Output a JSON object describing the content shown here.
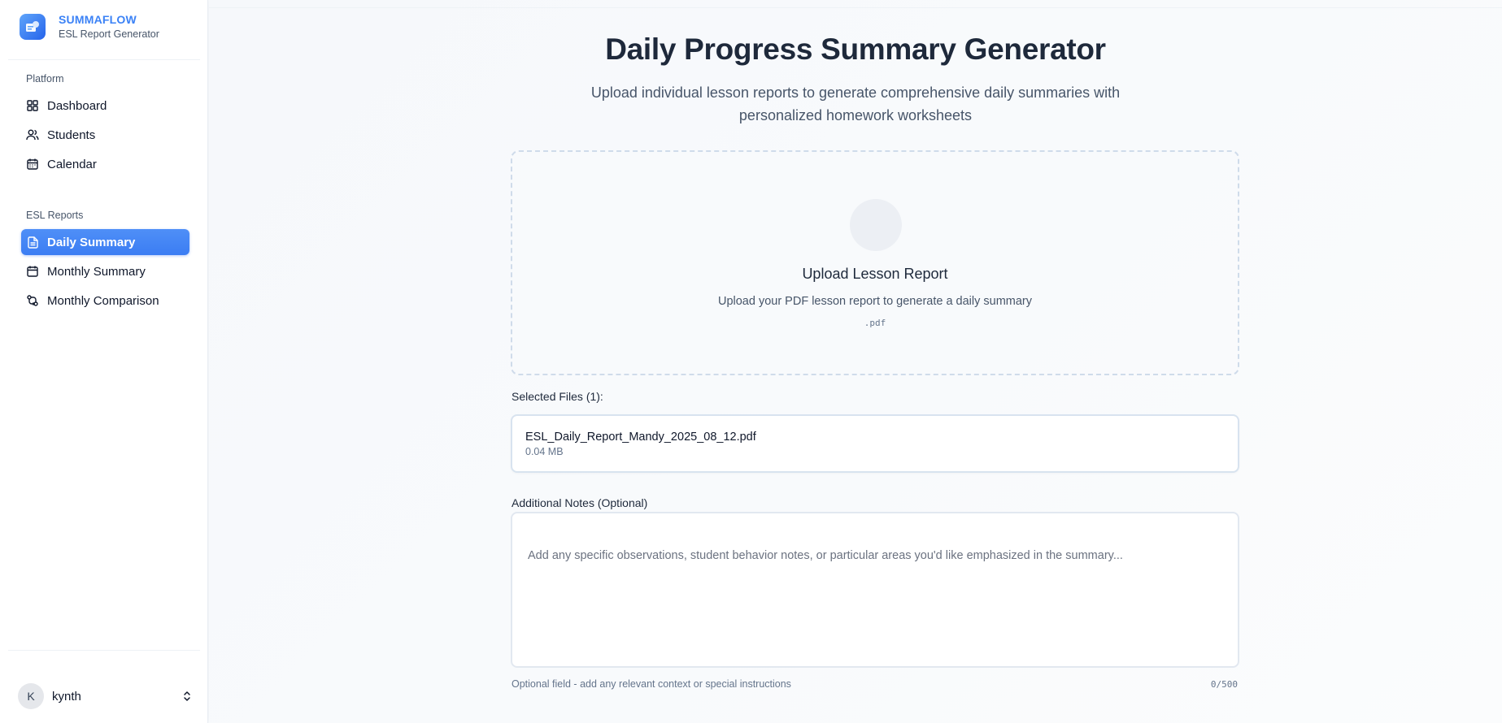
{
  "brand": {
    "name": "SUMMAFLOW",
    "subtitle": "ESL Report Generator",
    "logo_icon": "report-logo-icon"
  },
  "sidebar": {
    "sections": [
      {
        "label": "Platform",
        "items": [
          {
            "label": "Dashboard",
            "icon": "grid-icon"
          },
          {
            "label": "Students",
            "icon": "users-icon"
          },
          {
            "label": "Calendar",
            "icon": "calendar-icon"
          }
        ]
      },
      {
        "label": "ESL Reports",
        "items": [
          {
            "label": "Daily Summary",
            "icon": "file-text-icon",
            "active": true
          },
          {
            "label": "Monthly Summary",
            "icon": "calendar-icon"
          },
          {
            "label": "Monthly Comparison",
            "icon": "git-compare-icon"
          }
        ]
      }
    ],
    "user": {
      "initial": "K",
      "name": "kynth",
      "menu_icon": "chevrons-up-down-icon"
    }
  },
  "main": {
    "title": "Daily Progress Summary Generator",
    "subtitle": "Upload individual lesson reports to generate comprehensive daily summaries with personalized homework worksheets",
    "upload": {
      "title": "Upload Lesson Report",
      "description": "Upload your PDF lesson report to generate a daily summary",
      "accepted": ".pdf"
    },
    "selected_files": {
      "label": "Selected Files (1):",
      "files": [
        {
          "name": "ESL_Daily_Report_Mandy_2025_08_12.pdf",
          "size": "0.04 MB"
        }
      ]
    },
    "notes": {
      "label": "Additional Notes (Optional)",
      "placeholder": "Add any specific observations, student behavior notes, or particular areas you'd like emphasized in the summary...",
      "value": "",
      "help": "Optional field - add any relevant context or special instructions",
      "count": "0/500"
    }
  },
  "colors": {
    "accent": "#3b82f6",
    "active_nav": "#4286f5",
    "background": "#f8fafc"
  }
}
